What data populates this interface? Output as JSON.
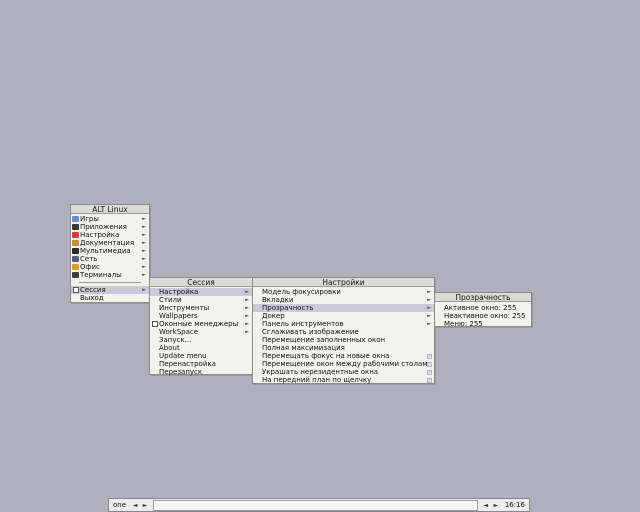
{
  "root_menu": {
    "title": "ALT Linux",
    "items": [
      {
        "label": "Игры",
        "icon": "games-icon",
        "color": "#6b8cc6"
      },
      {
        "label": "Приложения",
        "icon": "applications-icon",
        "color": "#3a3a3a"
      },
      {
        "label": "Настройка",
        "icon": "settings-icon",
        "color": "#d04040"
      },
      {
        "label": "Документация",
        "icon": "documentation-icon",
        "color": "#c09040"
      },
      {
        "label": "Мультимедиа",
        "icon": "multimedia-icon",
        "color": "#2a2a2a"
      },
      {
        "label": "Сеть",
        "icon": "network-icon",
        "color": "#5a5a7a"
      },
      {
        "label": "Офис",
        "icon": "office-icon",
        "color": "#d0a030"
      },
      {
        "label": "Терминалы",
        "icon": "terminals-icon",
        "color": "#404040"
      }
    ],
    "session_label": "Сессия",
    "exit_label": "Выход"
  },
  "session_menu": {
    "title": "Сессия",
    "items": [
      {
        "label": "Настройка",
        "arrow": true,
        "selected": true
      },
      {
        "label": "Стили",
        "arrow": true
      },
      {
        "label": "Инструменты",
        "arrow": true
      },
      {
        "label": "Wallpapers",
        "arrow": true
      },
      {
        "label": "Оконные менеджеры",
        "arrow": true,
        "box": true
      },
      {
        "label": "WorkSpace",
        "arrow": true
      },
      {
        "label": "Запуск..."
      },
      {
        "label": "About"
      },
      {
        "label": "Update menu"
      },
      {
        "label": "Перенастройка"
      },
      {
        "label": "Перезапуск"
      }
    ]
  },
  "config_menu": {
    "title": "Настройки",
    "items": [
      {
        "label": "Модель фокусировки",
        "arrow": true
      },
      {
        "label": "Вкладки",
        "arrow": true
      },
      {
        "label": "Прозрачность",
        "arrow": true,
        "selected": true
      },
      {
        "label": "Докер",
        "arrow": true
      },
      {
        "label": "Панель инструментов",
        "arrow": true
      },
      {
        "label": "Сглаживать изображение"
      },
      {
        "label": "Перемещение заполненных окон"
      },
      {
        "label": "Полная максимизация"
      },
      {
        "label": "Перемещать фокус на новые окна",
        "check": true
      },
      {
        "label": "Перемещение окон между рабочими столами",
        "check": true
      },
      {
        "label": "Украшать нерезидентные окна",
        "check": true
      },
      {
        "label": "На передний план по щелчку",
        "check": true
      }
    ]
  },
  "transparency_menu": {
    "title": "Прозрачность",
    "items": [
      {
        "label": "Активное окно:  255"
      },
      {
        "label": "Неактивное окно:  255"
      },
      {
        "label": "Меню:  255"
      }
    ]
  },
  "taskbar": {
    "workspace": "one",
    "prev": "◄",
    "next": "►",
    "clock": "16:16"
  },
  "colors": {
    "desktop": "#b0b0bd",
    "menu_bg": "#f3f3ee",
    "title_bg": "#dcdcd5",
    "selected_bg": "#c9c9d8"
  }
}
